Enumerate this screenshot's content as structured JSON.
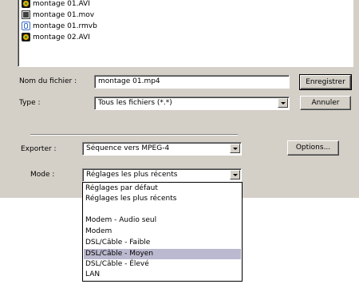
{
  "files": [
    {
      "name": "montage 01.AVI",
      "icon": "avi-file-icon"
    },
    {
      "name": "montage 01.mov",
      "icon": "mov-file-icon"
    },
    {
      "name": "montage 01.rmvb",
      "icon": "rmvb-file-icon"
    },
    {
      "name": "montage 02.AVI",
      "icon": "avi-file-icon"
    }
  ],
  "filename": {
    "label": "Nom du fichier :",
    "value": "montage 01.mp4"
  },
  "type": {
    "label": "Type :",
    "value": "Tous les fichiers (*.*)"
  },
  "buttons": {
    "save": "Enregistrer",
    "cancel": "Annuler",
    "options": "Options..."
  },
  "export": {
    "label": "Exporter :",
    "value": "Séquence vers MPEG-4"
  },
  "mode": {
    "label": "Mode :",
    "value": "Réglages les plus récents",
    "options": [
      "Réglages par défaut",
      "Réglages les plus récents",
      "Modem - Audio seul",
      "Modem",
      "DSL/Câble - Faible",
      "DSL/Câble - Moyen",
      "DSL/Câble - Élevé",
      "LAN"
    ],
    "highlighted": "DSL/Câble - Moyen"
  },
  "colors": {
    "dialog_bg": "#d4d0c8",
    "highlight": "#bab9cf"
  }
}
